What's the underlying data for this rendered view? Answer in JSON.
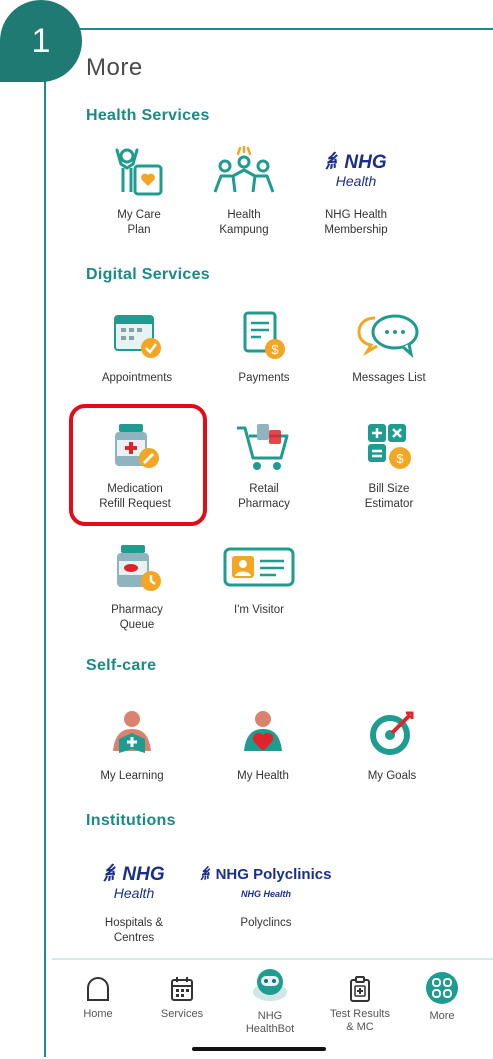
{
  "step_number": "1",
  "page_title": "More",
  "sections": {
    "health_services": {
      "title": "Health Services",
      "items": {
        "my_care_plan": "My Care\nPlan",
        "health_kampung": "Health\nKampung",
        "nhg_membership": "NHG Health\nMembership"
      }
    },
    "digital_services": {
      "title": "Digital Services",
      "items": {
        "appointments": "Appointments",
        "payments": "Payments",
        "messages_list": "Messages List",
        "medication_refill": "Medication\nRefill Request",
        "retail_pharmacy": "Retail\nPharmacy",
        "bill_size_estimator": "Bill Size\nEstimator",
        "pharmacy_queue": "Pharmacy\nQueue",
        "im_visitor": "I'm Visitor"
      }
    },
    "self_care": {
      "title": "Self-care",
      "items": {
        "my_learning": "My Learning",
        "my_health": "My Health",
        "my_goals": "My Goals"
      }
    },
    "institutions": {
      "title": "Institutions",
      "items": {
        "hospitals_centres": "Hospitals &\nCentres",
        "polyclinics": "Polyclincs"
      },
      "logos": {
        "nhg_main": "NHG",
        "nhg_sub": "Health",
        "poly_main": "NHG Polyclinics",
        "poly_sub": "NHG Health"
      }
    }
  },
  "membership_logo": {
    "main": "NHG",
    "sub": "Health"
  },
  "bottom_nav": {
    "home": "Home",
    "services": "Services",
    "healthbot": "NHG\nHealthBot",
    "test_results": "Test Results\n& MC",
    "more": "More"
  },
  "colors": {
    "brand_teal": "#1a8a86",
    "highlight_red": "#e20c18",
    "orange": "#f2a623",
    "icon_teal": "#1d9c8f"
  }
}
